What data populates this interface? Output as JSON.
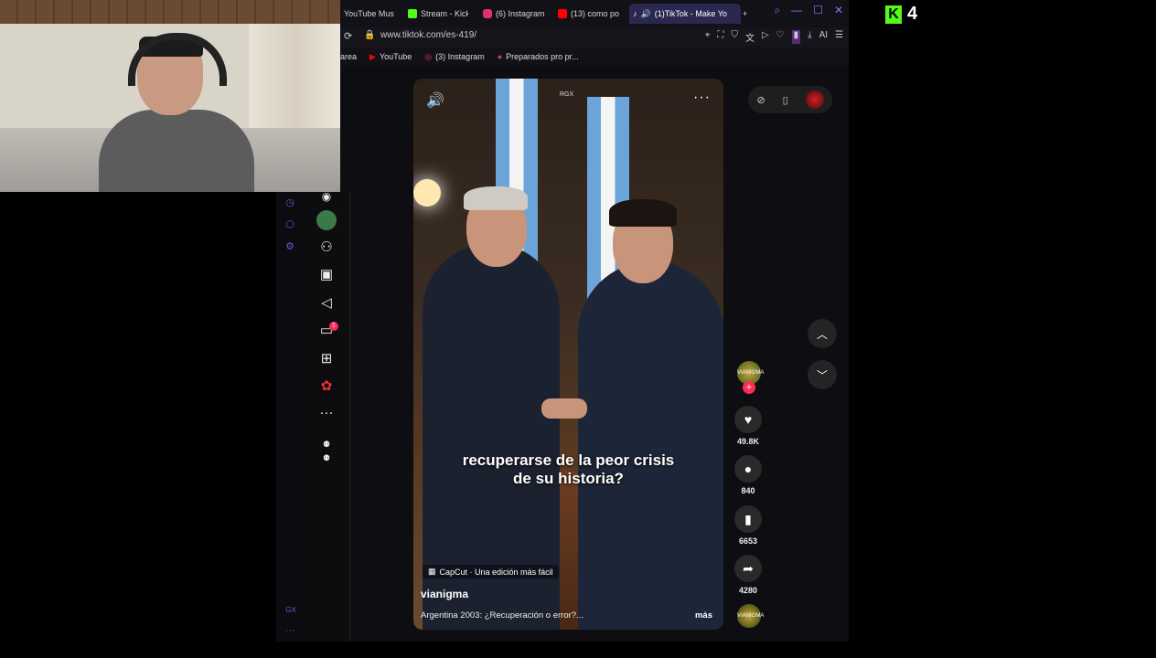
{
  "kick": {
    "logo": "K",
    "count": "4"
  },
  "tabs": [
    {
      "label": "YouTube Mus",
      "icon_color": "#ff0000"
    },
    {
      "label": "Stream - Kick",
      "icon_color": "#53fc18"
    },
    {
      "label": "(6) Instagram",
      "icon_color": "#e1306c"
    },
    {
      "label": "(13) como po",
      "icon_color": "#ff0000"
    },
    {
      "label": "(1)TikTok - Make Yo",
      "icon_color": "#ffffff"
    }
  ],
  "tab_controls": {
    "new_tab": "+",
    "search": "⌕",
    "minimize": "—",
    "maximize": "☐",
    "close": "✕"
  },
  "address": {
    "url": "www.tiktok.com/es-419/",
    "ai": "AI"
  },
  "bookmarks": [
    {
      "label": "area"
    },
    {
      "label": "YouTube"
    },
    {
      "label": "(3) Instagram"
    },
    {
      "label": "Preparados pro pr..."
    }
  ],
  "video": {
    "overlay_tag": "RGX",
    "caption_line1": "recuperarse de la peor crisis",
    "caption_line2": "de su historia?",
    "capcut": "CapCut · Una edición más fácil",
    "author": "vianigma",
    "description": "Argentina 2003: ¿Recuperación o error?...",
    "more": "más"
  },
  "actions": {
    "likes": "49.8K",
    "comments": "840",
    "saves": "6653",
    "shares": "4280"
  },
  "avatar_text": "VIANIGMA",
  "sidebar": {
    "notifications_badge": "1"
  },
  "opera_sidebar": {
    "gx_label": "GX",
    "more": "···"
  }
}
